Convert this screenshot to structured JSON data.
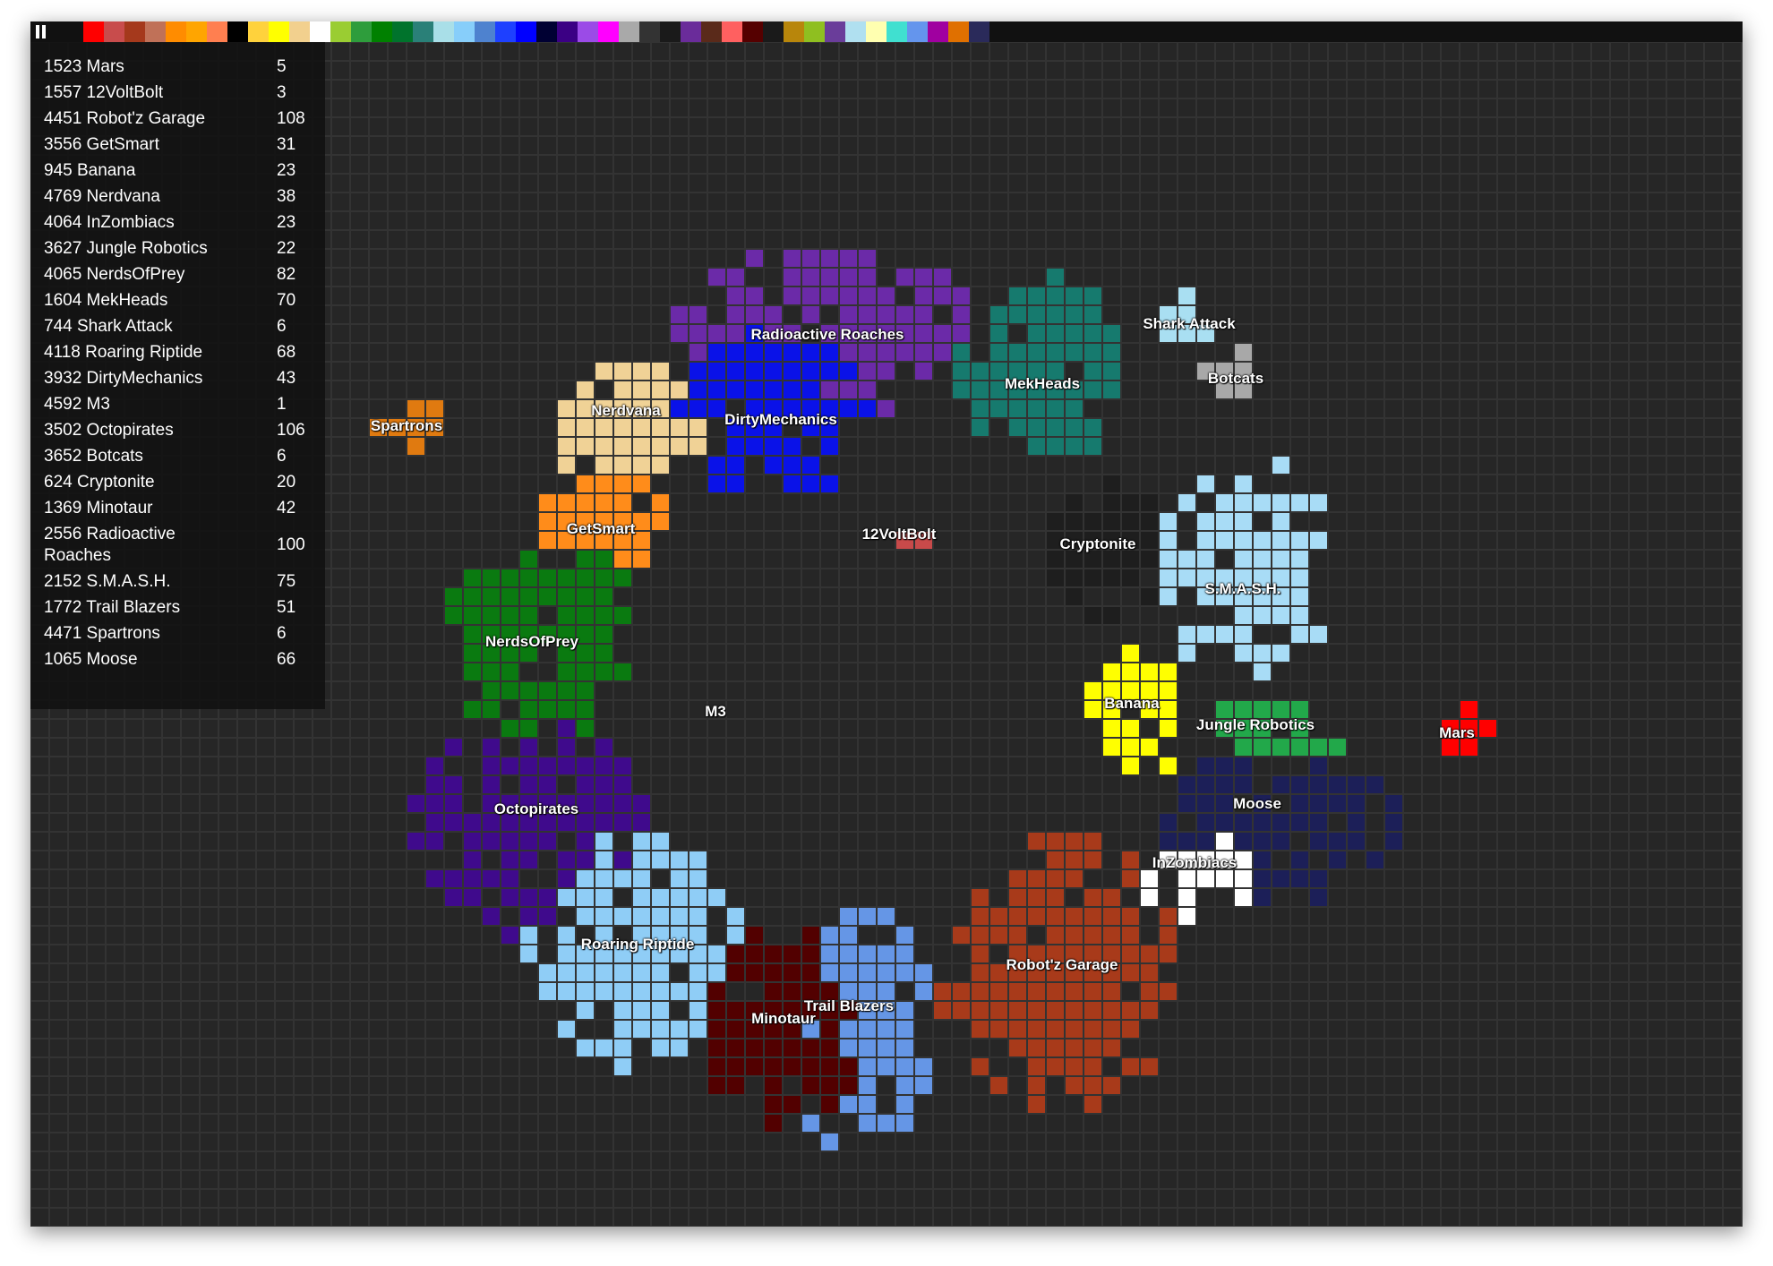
{
  "ui": {
    "pause_icon": "pause-icon",
    "palette": [
      "#ff0000",
      "#c84c4c",
      "#a5391c",
      "#c07158",
      "#ff8c00",
      "#ffa500",
      "#ff7f50",
      "#000000",
      "#ffd23c",
      "#ffff00",
      "#f2d08e",
      "#ffffff",
      "#9acd32",
      "#2e9d3c",
      "#008000",
      "#00732c",
      "#2a8078",
      "#a9dfe8",
      "#87cefa",
      "#4e82cf",
      "#1e40ff",
      "#0000ff",
      "#000033",
      "#3b0084",
      "#9b4be7",
      "#ff00ff",
      "#a9a9a9",
      "#333333",
      "#1a1a1a",
      "#6a2c9a",
      "#5a2a1a",
      "#ff6060",
      "#550000",
      "#1a1a1a",
      "#b8860b",
      "#8fbf20",
      "#6a3d9a",
      "#b0e0f0",
      "#ffffb0",
      "#40e0d0",
      "#6495ed",
      "#a000a0",
      "#e07000",
      "#2a2a5a"
    ]
  },
  "leaderboard": [
    {
      "name": "1523 Mars",
      "score": "5"
    },
    {
      "name": "1557 12VoltBolt",
      "score": "3"
    },
    {
      "name": "4451 Robot'z Garage",
      "score": "108"
    },
    {
      "name": "3556 GetSmart",
      "score": "31"
    },
    {
      "name": "945 Banana",
      "score": "23"
    },
    {
      "name": "4769 Nerdvana",
      "score": "38"
    },
    {
      "name": "4064 InZombiacs",
      "score": "23"
    },
    {
      "name": "3627 Jungle Robotics",
      "score": "22"
    },
    {
      "name": "4065 NerdsOfPrey",
      "score": "82"
    },
    {
      "name": "1604 MekHeads",
      "score": "70"
    },
    {
      "name": "744 Shark Attack",
      "score": "6"
    },
    {
      "name": "4118 Roaring Riptide",
      "score": "68"
    },
    {
      "name": "3932 DirtyMechanics",
      "score": "43"
    },
    {
      "name": "4592 M3",
      "score": "1"
    },
    {
      "name": "3502 Octopirates",
      "score": "106"
    },
    {
      "name": "3652 Botcats",
      "score": "6"
    },
    {
      "name": "624 Cryptonite",
      "score": "20"
    },
    {
      "name": "1369 Minotaur",
      "score": "42"
    },
    {
      "name": "2556 Radioactive Roaches",
      "score": "100"
    },
    {
      "name": "2152 S.M.A.S.H.",
      "score": "75"
    },
    {
      "name": "1772 Trail Blazers",
      "score": "51"
    },
    {
      "name": "4471 Spartrons",
      "score": "6"
    },
    {
      "name": "1065 Moose",
      "score": "66"
    }
  ],
  "teams": [
    {
      "name": "Radioactive Roaches",
      "color": "#6b2aa8"
    },
    {
      "name": "DirtyMechanics",
      "color": "#0a12e8"
    },
    {
      "name": "MekHeads",
      "color": "#167a6e"
    },
    {
      "name": "Shark Attack",
      "color": "#a9dff2"
    },
    {
      "name": "Botcats",
      "color": "#a8a8a8"
    },
    {
      "name": "Nerdvana",
      "color": "#f0d296"
    },
    {
      "name": "Spartrons",
      "color": "#e07a10"
    },
    {
      "name": "GetSmart",
      "color": "#ff8c1a"
    },
    {
      "name": "12VoltBolt",
      "color": "#c84a4a"
    },
    {
      "name": "Cryptonite",
      "color": "#1e1e1e"
    },
    {
      "name": "S.M.A.S.H.",
      "color": "#a8dcf6"
    },
    {
      "name": "NerdsOfPrey",
      "color": "#0a7a10"
    },
    {
      "name": "M3",
      "color": "#0a7a10"
    },
    {
      "name": "Banana",
      "color": "#ffff00"
    },
    {
      "name": "Jungle Robotics",
      "color": "#22a84a"
    },
    {
      "name": "Mars",
      "color": "#ff0000"
    },
    {
      "name": "Octopirates",
      "color": "#3f0a8c"
    },
    {
      "name": "Moose",
      "color": "#1c1f58"
    },
    {
      "name": "InZombiacs",
      "color": "#ffffff"
    },
    {
      "name": "Roaring Riptide",
      "color": "#8fcdf6"
    },
    {
      "name": "Robot'z Garage",
      "color": "#a83a1a"
    },
    {
      "name": "Trail Blazers",
      "color": "#6596e6"
    },
    {
      "name": "Minotaur",
      "color": "#520000"
    }
  ]
}
